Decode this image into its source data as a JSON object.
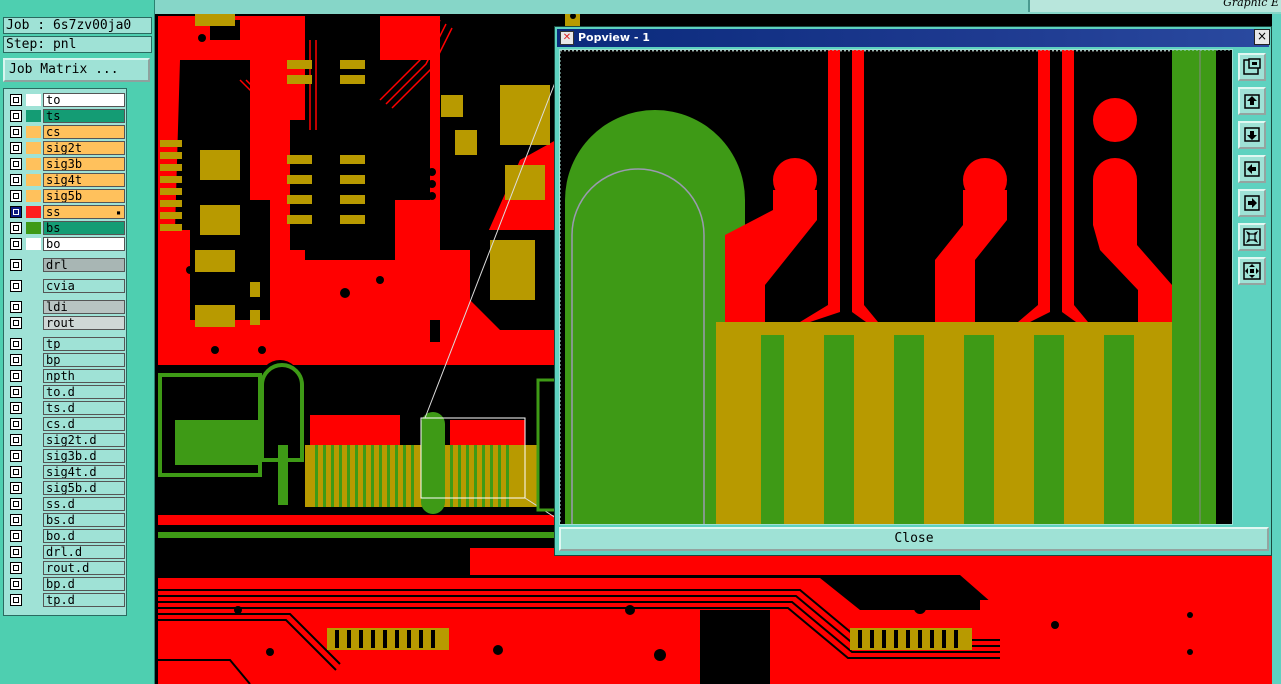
{
  "job": {
    "label": "Job : 6s7zv00ja0",
    "step": "Step: pnl",
    "matrix_button": "Job Matrix ..."
  },
  "layers": [
    {
      "name": "to",
      "color": "#ffffff",
      "bg": "#ffffff",
      "checked": false
    },
    {
      "name": "ts",
      "color": "#149c74",
      "bg": "#149c74",
      "checked": false
    },
    {
      "name": "cs",
      "color": "#ffc15c",
      "bg": "#ffc15c",
      "checked": false
    },
    {
      "name": "sig2t",
      "color": "#ffc15c",
      "bg": "#ffc15c",
      "checked": false
    },
    {
      "name": "sig3b",
      "color": "#ffc15c",
      "bg": "#ffc15c",
      "checked": false
    },
    {
      "name": "sig4t",
      "color": "#ffc15c",
      "bg": "#ffc15c",
      "checked": false
    },
    {
      "name": "sig5b",
      "color": "#ffc15c",
      "bg": "#ffc15c",
      "checked": false
    },
    {
      "name": "ss",
      "color": "#ff1e1e",
      "bg": "#ffc15c",
      "checked": true
    },
    {
      "name": "bs",
      "color": "#3e9a16",
      "bg": "#149c74",
      "checked": false
    },
    {
      "name": "bo",
      "color": "#ffffff",
      "bg": "#ffffff",
      "checked": false
    },
    {
      "name": "drl",
      "color": "#9fe2d6",
      "bg": "#a8b6b4",
      "checked": false
    },
    {
      "name": "cvia",
      "color": "#9fe2d6",
      "bg": "#9fe2d6",
      "checked": false
    },
    {
      "name": "ldi",
      "color": "#9fe2d6",
      "bg": "#b8c4c2",
      "checked": false
    },
    {
      "name": "rout",
      "color": "#9fe2d6",
      "bg": "#cfd8d6",
      "checked": false
    },
    {
      "name": "tp",
      "color": "#9fe2d6",
      "bg": "#9fe2d6",
      "checked": false
    },
    {
      "name": "bp",
      "color": "#9fe2d6",
      "bg": "#9fe2d6",
      "checked": false
    },
    {
      "name": "npth",
      "color": "#9fe2d6",
      "bg": "#9fe2d6",
      "checked": false
    },
    {
      "name": "to.d",
      "color": "#9fe2d6",
      "bg": "#9fe2d6",
      "checked": false
    },
    {
      "name": "ts.d",
      "color": "#9fe2d6",
      "bg": "#9fe2d6",
      "checked": false
    },
    {
      "name": "cs.d",
      "color": "#9fe2d6",
      "bg": "#9fe2d6",
      "checked": false
    },
    {
      "name": "sig2t.d",
      "color": "#9fe2d6",
      "bg": "#9fe2d6",
      "checked": false
    },
    {
      "name": "sig3b.d",
      "color": "#9fe2d6",
      "bg": "#9fe2d6",
      "checked": false
    },
    {
      "name": "sig4t.d",
      "color": "#9fe2d6",
      "bg": "#9fe2d6",
      "checked": false
    },
    {
      "name": "sig5b.d",
      "color": "#9fe2d6",
      "bg": "#9fe2d6",
      "checked": false
    },
    {
      "name": "ss.d",
      "color": "#9fe2d6",
      "bg": "#9fe2d6",
      "checked": false
    },
    {
      "name": "bs.d",
      "color": "#9fe2d6",
      "bg": "#9fe2d6",
      "checked": false
    },
    {
      "name": "bo.d",
      "color": "#9fe2d6",
      "bg": "#9fe2d6",
      "checked": false
    },
    {
      "name": "drl.d",
      "color": "#9fe2d6",
      "bg": "#9fe2d6",
      "checked": false
    },
    {
      "name": "rout.d",
      "color": "#9fe2d6",
      "bg": "#9fe2d6",
      "checked": false
    },
    {
      "name": "bp.d",
      "color": "#9fe2d6",
      "bg": "#9fe2d6",
      "checked": false
    },
    {
      "name": "tp.d",
      "color": "#9fe2d6",
      "bg": "#9fe2d6",
      "checked": false
    }
  ],
  "graphic_label": "Graphic E",
  "popview": {
    "title": "Popview - 1",
    "close_x": "×",
    "close_button": "Close",
    "tools": [
      "zoom-page-icon",
      "zoom-up-icon",
      "zoom-down-icon",
      "pan-left-icon",
      "pan-right-icon",
      "zoom-out-icon",
      "zoom-fit-icon"
    ]
  },
  "colors": {
    "copper": "#ff0000",
    "mask": "#3e9a16",
    "pad": "#b89a00",
    "panel": "#4ecfb0"
  }
}
